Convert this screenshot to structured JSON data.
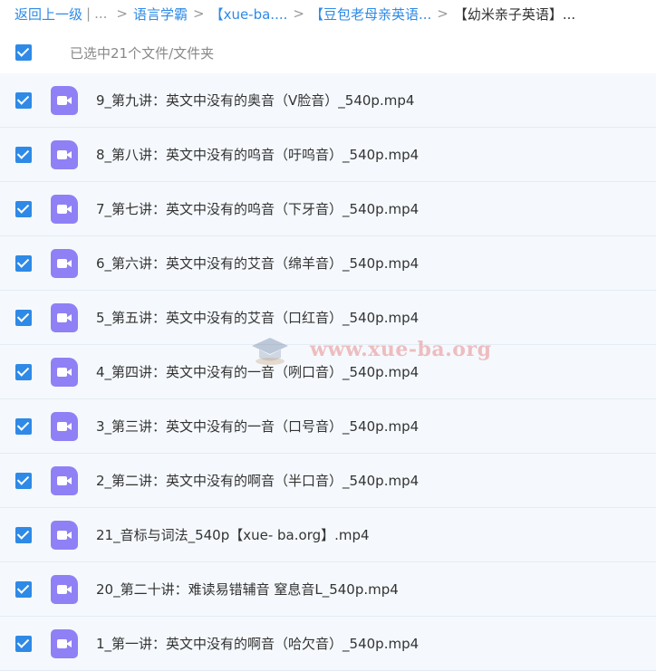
{
  "breadcrumb": {
    "back": "返回上一级",
    "divider": "|",
    "ellipsis": "...",
    "sep": ">",
    "item1": "语言学霸",
    "item2": "【xue-ba....",
    "item3": "【豆包老母亲英语...",
    "current": "【幼米亲子英语】..."
  },
  "selection": {
    "status": "已选中21个文件/文件夹"
  },
  "files": [
    "9_第九讲：英文中没有的奥音（V脸音）_540p.mp4",
    "8_第八讲：英文中没有的呜音（吁呜音）_540p.mp4",
    "7_第七讲：英文中没有的呜音（下牙音）_540p.mp4",
    "6_第六讲：英文中没有的艾音（绵羊音）_540p.mp4",
    "5_第五讲：英文中没有的艾音（口红音）_540p.mp4",
    "4_第四讲：英文中没有的一音（咧口音）_540p.mp4",
    "3_第三讲：英文中没有的一音（口号音）_540p.mp4",
    "2_第二讲：英文中没有的啊音（半口音）_540p.mp4",
    "21_音标与词法_540p【xue- ba.org】.mp4",
    "20_第二十讲：难读易错辅音 窒息音L_540p.mp4",
    "1_第一讲：英文中没有的啊音（哈欠音）_540p.mp4"
  ],
  "watermark": {
    "text": "www.xue-ba.org"
  },
  "colors": {
    "accent": "#2e8ae6",
    "row_bg": "#f5f9fd",
    "video_icon": "#8f80f5"
  },
  "icons": {
    "file": "video-file-icon",
    "check": "checkbox-checked-icon",
    "watermark": "graduation-cap-icon"
  }
}
